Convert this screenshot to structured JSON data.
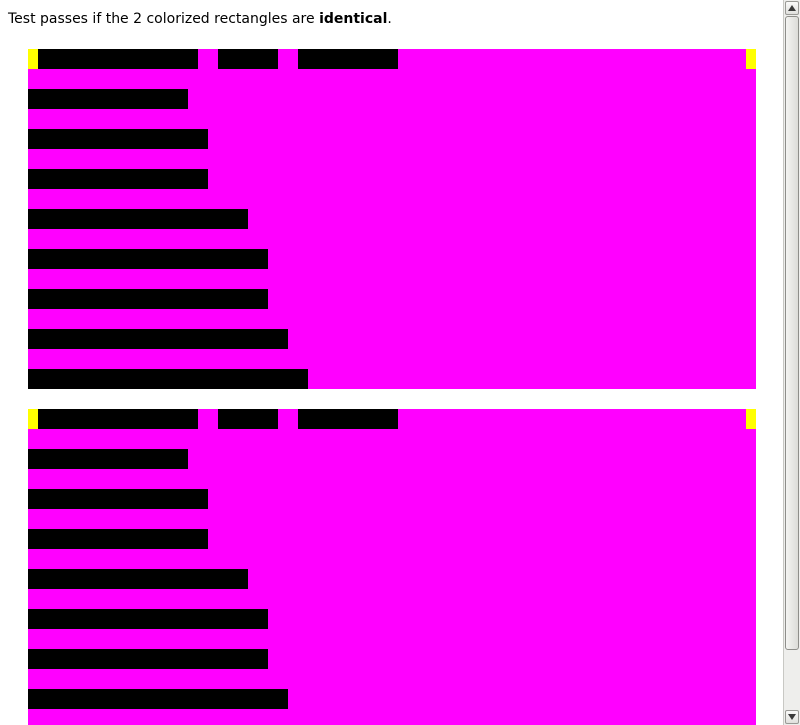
{
  "instruction": {
    "prefix": "Test passes if the 2 colorized rectangles are ",
    "emphasis": "identical",
    "suffix": "."
  },
  "colors": {
    "background": "#ffffff",
    "box_fill": "#ff00ff",
    "bar_fill": "#000000",
    "marker_fill": "#ffff00",
    "scrollbar_track": "#eeeeec"
  },
  "boxes": [
    {
      "id": "test",
      "rows": 8
    },
    {
      "id": "reference",
      "rows": 8
    }
  ],
  "scrollbar": {
    "up_icon": "scroll-up-arrow-icon",
    "down_icon": "scroll-down-arrow-icon"
  }
}
